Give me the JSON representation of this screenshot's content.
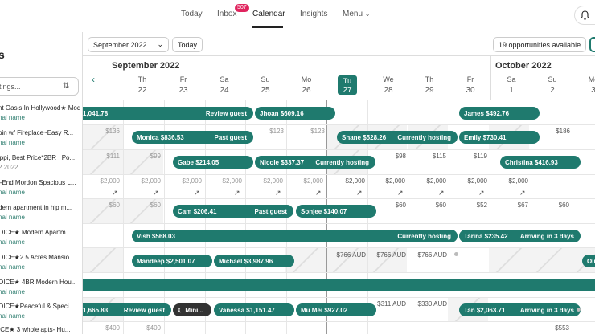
{
  "nav": {
    "today": "Today",
    "inbox": "Inbox",
    "inbox_badge": "507",
    "calendar": "Calendar",
    "insights": "Insights",
    "menu": "Menu"
  },
  "sidebar": {
    "title": "s",
    "search_placeholder": "tings...",
    "listings": [
      {
        "name": "nt Oasis In Hollywood★ Mod...",
        "sub": "nal name"
      },
      {
        "name": "bin w/ Fireplace~Easy R...",
        "sub": "nal name"
      },
      {
        "name": "ippi, Best Price*2BR , Po...",
        "sub": "2 2022"
      },
      {
        "name": "l-End Mordon Spacious L...",
        "sub": "nal name"
      },
      {
        "name": "dern apartment in hip m...",
        "sub": "nal name"
      },
      {
        "name": "OICE★ Modern Apartm...",
        "sub": "nal name"
      },
      {
        "name": "OICE★2.5 Acres Mansio...",
        "sub": "nal name"
      },
      {
        "name": "OICE★ 4BR Modern Hou...",
        "sub": "nal name"
      },
      {
        "name": "OICE★Peaceful & Speci...",
        "sub": "nal name"
      },
      {
        "name": "ICE★ 3 whole apts- Hu...",
        "sub": ""
      }
    ]
  },
  "toolbar": {
    "month_select": "September 2022",
    "today_button": "Today",
    "opportunities": "19 opportunities available"
  },
  "header": {
    "month1": "September 2022",
    "month2": "October 2022",
    "days": [
      {
        "dow": "Th",
        "num": "22"
      },
      {
        "dow": "Fr",
        "num": "23"
      },
      {
        "dow": "Sa",
        "num": "24"
      },
      {
        "dow": "Su",
        "num": "25"
      },
      {
        "dow": "Mo",
        "num": "26"
      },
      {
        "dow": "Tu",
        "num": "27"
      },
      {
        "dow": "We",
        "num": "28"
      },
      {
        "dow": "Th",
        "num": "29"
      },
      {
        "dow": "Fr",
        "num": "30"
      },
      {
        "dow": "Sa",
        "num": "1"
      },
      {
        "dow": "Su",
        "num": "2"
      },
      {
        "dow": "Mo",
        "num": "3"
      }
    ]
  },
  "reservations": {
    "r1a": {
      "text": "1,041.78",
      "status": "Review guest"
    },
    "r1b": {
      "text": "Jhoan  $609.16"
    },
    "r1c": {
      "text": "James  $492.76"
    },
    "r2a": {
      "text": "Monica  $836.53",
      "status": "Past guest"
    },
    "r2b": {
      "text": "Shane  $528.26",
      "status": "Currently hosting"
    },
    "r2c": {
      "text": "Emily  $730.41"
    },
    "r3a": {
      "text": "Gabe  $214.05"
    },
    "r3b": {
      "text": "Nicole  $337.37",
      "status": "Currently hosting"
    },
    "r3c": {
      "text": "Christina  $416.93"
    },
    "r5a": {
      "text": "Cam  $206.41",
      "status": "Past guest"
    },
    "r5b": {
      "text": "Sonjee  $140.07"
    },
    "r6a": {
      "text": "Vish  $568.03",
      "status": "Currently hosting"
    },
    "r6b": {
      "text": "Tarina  $235.42",
      "status": "Arriving in 3 days"
    },
    "r7a": {
      "text": "Mandeep  $2,501.07"
    },
    "r7b": {
      "text": "Michael  $3,987.96"
    },
    "r7c": {
      "text": "Oli"
    },
    "r9a": {
      "text": "1,665.83",
      "status": "Review guest"
    },
    "r9b": {
      "text": "Mini..."
    },
    "r9c": {
      "text": "Vanessa  $1,151.47"
    },
    "r9d": {
      "text": "Mu Mei  $927.02"
    },
    "r9e": {
      "text": "Tan  $2,063.71",
      "status": "Arriving in 3 days"
    }
  },
  "prices": {
    "p2_su": "$123",
    "p2_mo": "$123",
    "p2_fr": "$186",
    "p2_th": "$136",
    "p3_th": "$111",
    "p3_fr": "$99",
    "p3_we": "$98",
    "p3_th2": "$115",
    "p3_fr2": "$119",
    "p4": [
      "$2,000",
      "$2,000",
      "$2,000",
      "$2,000",
      "$2,000",
      "$2,000",
      "$2,000",
      "$2,000",
      "$2,000",
      "$2,000",
      "$2,000"
    ],
    "p5_th": "$60",
    "p5_fr": "$60",
    "p5_we": "$60",
    "p5_th2": "$60",
    "p5_fr2": "$52",
    "p5_sa": "$67",
    "p5_su": "$60",
    "p7_tu": "$766 AUD",
    "p7_we": "$766 AUD",
    "p7_th": "$766 AUD",
    "p9_we": "$311 AUD",
    "p9_th": "$330 AUD",
    "p10_th": "$400",
    "p10_fr": "$400",
    "p10_su": "$553"
  }
}
